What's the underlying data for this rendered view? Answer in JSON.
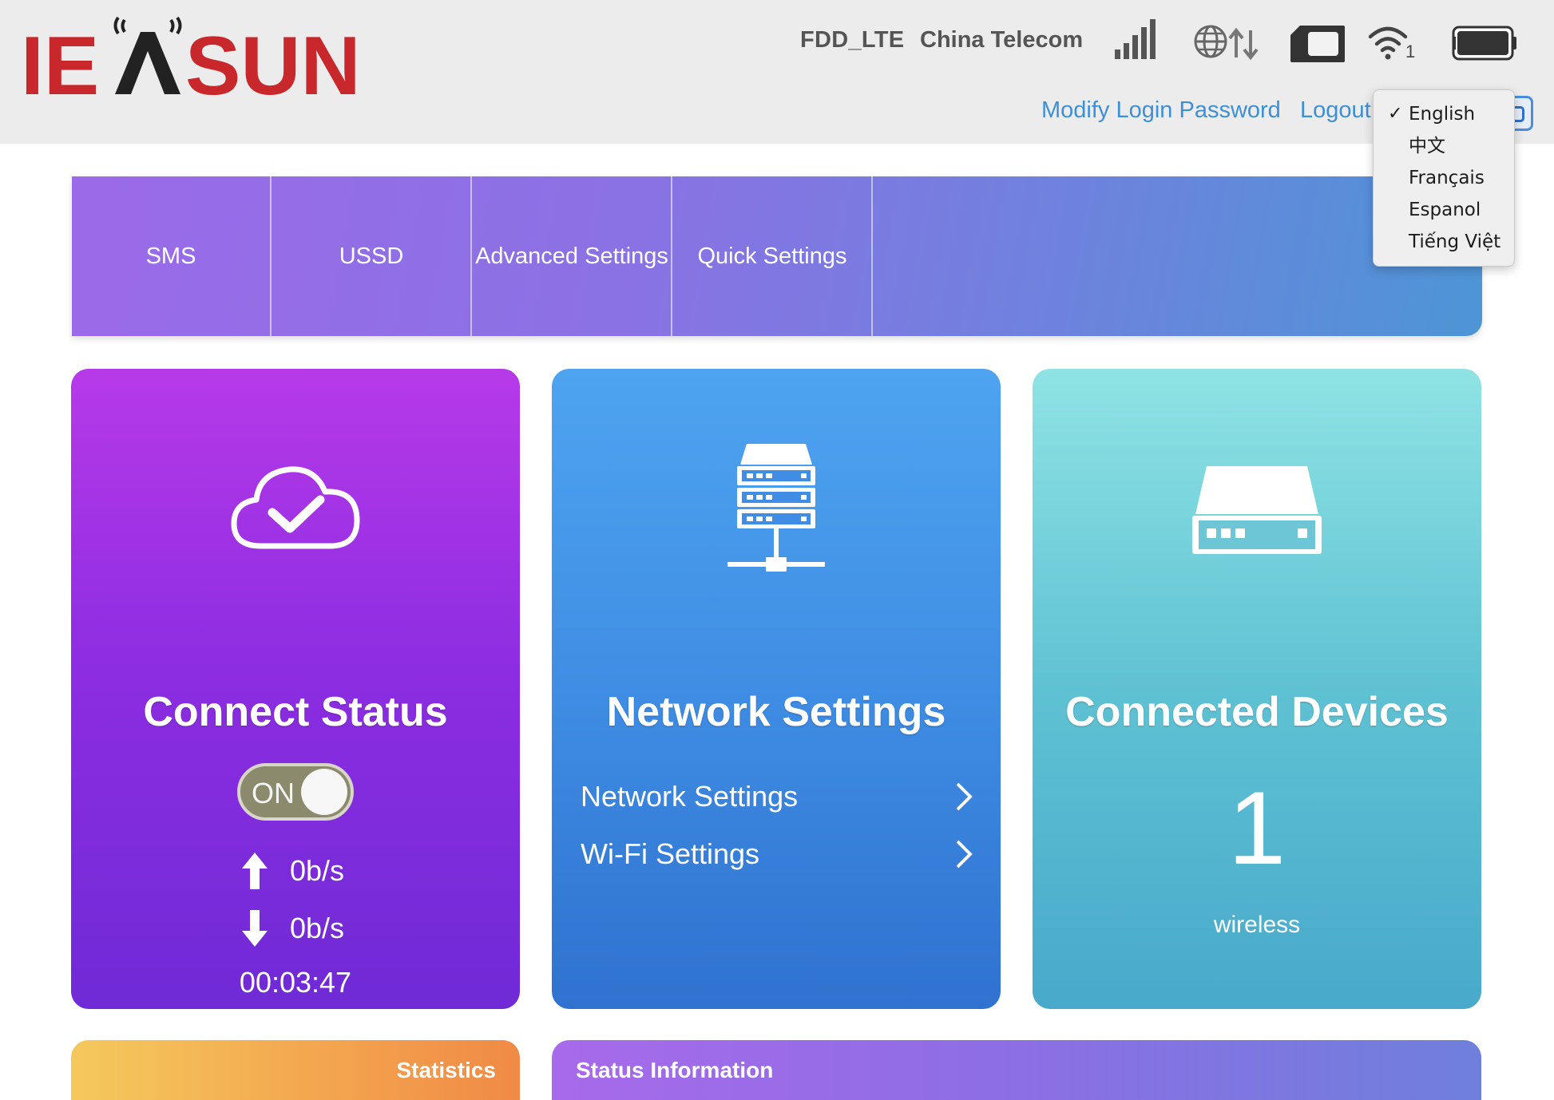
{
  "header": {
    "logo_text": "IEASUN",
    "network_type": "FDD_LTE",
    "carrier": "China Telecom",
    "wifi_clients": "1",
    "modify_password": "Modify Login Password",
    "logout": "Logout"
  },
  "language_menu": {
    "selected": "English",
    "items": [
      "English",
      "中文",
      "Français",
      "Espanol",
      "Tiếng Việt"
    ]
  },
  "nav": {
    "tabs": [
      "SMS",
      "USSD",
      "Advanced Settings",
      "Quick Settings"
    ]
  },
  "connect_status": {
    "title": "Connect Status",
    "toggle_label": "ON",
    "upload_rate": "0b/s",
    "download_rate": "0b/s",
    "uptime": "00:03:47"
  },
  "network_settings": {
    "title": "Network Settings",
    "links": [
      "Network Settings",
      "Wi-Fi Settings"
    ]
  },
  "connected_devices": {
    "title": "Connected Devices",
    "count": "1",
    "label": "wireless"
  },
  "panels": {
    "statistics": "Statistics",
    "status_information": "Status Information"
  },
  "colors": {
    "logo_red": "#c8282c",
    "link_blue": "#3d8fd6",
    "connect_card": "#9a30e4",
    "network_card": "#3f8de4",
    "devices_card": "#5fc2d3"
  }
}
